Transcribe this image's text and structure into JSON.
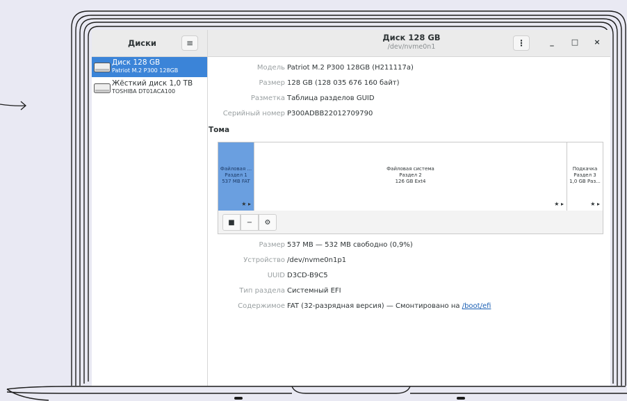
{
  "app": {
    "sidebar_title": "Диски",
    "title": "Диск 128 GB",
    "subtitle": "/dev/nvme0n1",
    "menu_icon": "hamburger-icon",
    "kebab_icon": "vertical-dots-icon",
    "window_controls": {
      "minimize": "_",
      "maximize": "□",
      "close": "×"
    }
  },
  "drives": [
    {
      "name": "Диск 128 GB",
      "model": "Patriot M.2 P300 128GB",
      "selected": true
    },
    {
      "name": "Жёсткий диск 1,0 TB",
      "model": "TOSHIBA DT01ACA100",
      "selected": false
    }
  ],
  "info": [
    {
      "label": "Модель",
      "value": "Patriot M.2 P300 128GB (H211117a)"
    },
    {
      "label": "Размер",
      "value": "128 GB (128 035 676 160 байт)"
    },
    {
      "label": "Разметка",
      "value": "Таблица разделов GUID"
    },
    {
      "label": "Серийный номер",
      "value": "P300ADBB22012709790"
    }
  ],
  "volumes": {
    "title": "Тома",
    "segments": [
      {
        "line1": "Файловая ...",
        "line2": "Раздел 1",
        "line3": "537 MB FAT",
        "selected": true
      },
      {
        "line1": "Файловая система",
        "line2": "Раздел 2",
        "line3": "126 GB Ext4",
        "selected": false
      },
      {
        "line1": "Подкачка",
        "line2": "Раздел 3",
        "line3": "1,0 GB Раз...",
        "selected": false
      }
    ],
    "flags": "★ ▸",
    "toolbar": {
      "stop": "■",
      "remove": "−",
      "settings": "⚙"
    }
  },
  "details": [
    {
      "label": "Размер",
      "value": "537 MB — 532 MB свободно (0,9%)"
    },
    {
      "label": "Устройство",
      "value": "/dev/nvme0n1p1"
    },
    {
      "label": "UUID",
      "value": "D3CD-B9C5"
    },
    {
      "label": "Тип раздела",
      "value": "Системный EFI"
    },
    {
      "label": "Содержимое",
      "value": "FAT (32-разрядная версия) — Смонтировано на ",
      "link": "/boot/efi"
    }
  ],
  "colors": {
    "accent": "#3b84d8",
    "segment_selected": "#6a9fe0",
    "link": "#1a5fb4",
    "background": "#e9e9f3"
  }
}
